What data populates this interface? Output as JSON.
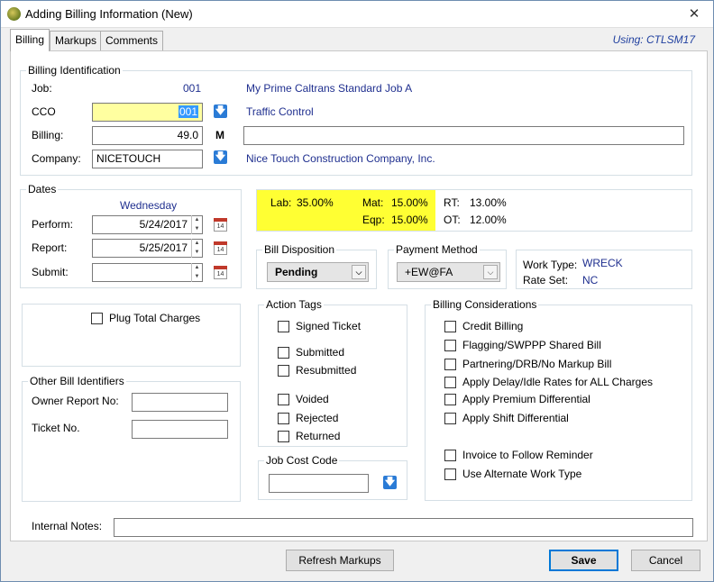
{
  "window": {
    "title": "Adding Billing Information  (New)",
    "close_glyph": "✕"
  },
  "tabs": [
    {
      "label": "Billing"
    },
    {
      "label": "Markups"
    },
    {
      "label": "Comments"
    }
  ],
  "using": "Using: CTLSM17",
  "billing_identification": {
    "title": "Billing Identification",
    "job_label": "Job:",
    "job_value": "001",
    "job_name": "My Prime Caltrans Standard Job A",
    "cco_label": "CCO",
    "cco_value": "001",
    "cco_name": "Traffic Control",
    "billing_label": "Billing:",
    "billing_value": "49.0",
    "billing_flag": "M",
    "billing_desc": "",
    "company_label": "Company:",
    "company_value": "NICETOUCH",
    "company_name": "Nice Touch Construction Company, Inc."
  },
  "dates": {
    "title": "Dates",
    "day": "Wednesday",
    "perform_label": "Perform:",
    "perform_value": "5/24/2017",
    "report_label": "Report:",
    "report_value": "5/25/2017",
    "submit_label": "Submit:",
    "submit_value": "",
    "calendar_day": "14"
  },
  "rates": {
    "lab_label": "Lab:",
    "lab_value": "35.00%",
    "mat_label": "Mat:",
    "mat_value": "15.00%",
    "eqp_label": "Eqp:",
    "eqp_value": "15.00%",
    "rt_label": "RT:",
    "rt_value": "13.00%",
    "ot_label": "OT:",
    "ot_value": "12.00%",
    "highlight_color": "#ffff33"
  },
  "bill_disposition": {
    "title": "Bill Disposition",
    "value": "Pending"
  },
  "payment_method": {
    "title": "Payment Method",
    "value": "+EW@FA"
  },
  "work_info": {
    "work_type_label": "Work Type:",
    "work_type_value": "WRECK",
    "rate_set_label": "Rate Set:",
    "rate_set_value": "NC"
  },
  "plug_total": {
    "label": "Plug Total Charges",
    "checked": false
  },
  "action_tags": {
    "title": "Action Tags",
    "items": [
      "Signed Ticket",
      "Submitted",
      "Resubmitted",
      "Voided",
      "Rejected",
      "Returned"
    ]
  },
  "billing_considerations": {
    "title": "Billing Considerations",
    "items": [
      "Credit Billing",
      "Flagging/SWPPP Shared Bill",
      "Partnering/DRB/No Markup Bill",
      "Apply Delay/Idle Rates for ALL Charges",
      "Apply Premium Differential",
      "Apply Shift Differential",
      "Invoice to Follow Reminder",
      "Use Alternate Work Type"
    ]
  },
  "other_bill_identifiers": {
    "title": "Other Bill Identifiers",
    "owner_report_label": "Owner Report No:",
    "owner_report_value": "",
    "ticket_label": "Ticket No.",
    "ticket_value": ""
  },
  "job_cost_code": {
    "title": "Job Cost Code",
    "value": ""
  },
  "internal_notes": {
    "label": "Internal Notes:",
    "value": ""
  },
  "buttons": {
    "refresh": "Refresh Markups",
    "save": "Save",
    "cancel": "Cancel"
  },
  "icons": {
    "dropdown": "arrow-down-icon",
    "calendar": "calendar-icon",
    "spin": "spin-icon"
  }
}
